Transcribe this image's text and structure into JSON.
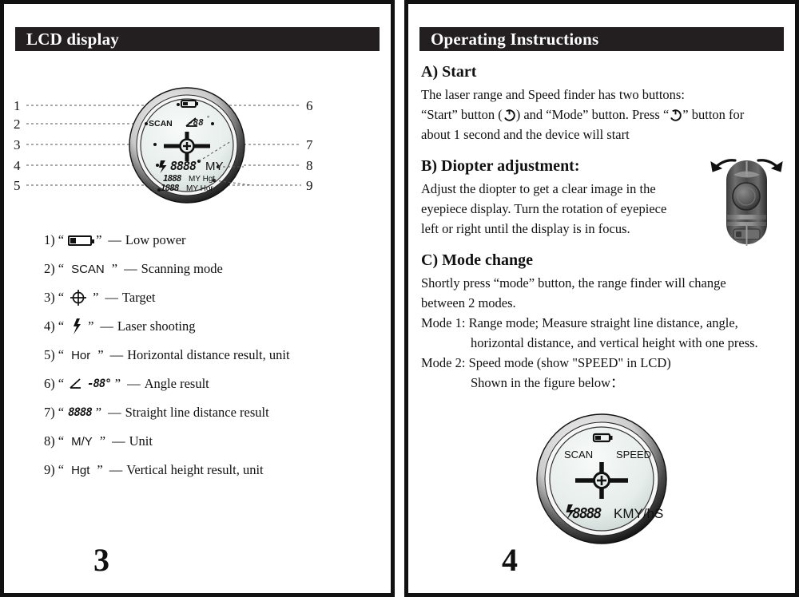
{
  "left_page": {
    "header_title": "LCD display",
    "page_number": "3",
    "figure": {
      "callouts_left": [
        "1",
        "2",
        "3",
        "4",
        "5"
      ],
      "callouts_right": [
        "6",
        "7",
        "8",
        "9"
      ],
      "lcd_labels": {
        "scan": "SCAN",
        "angle": "-88",
        "angle_degree": "°",
        "main_value": "8888",
        "main_unit": "MY",
        "hgt_value": "1888",
        "hgt_unit": "MY Hgt",
        "hor_value": "1888",
        "hor_unit": "MY Hor"
      }
    },
    "legend": [
      {
        "num": "1)",
        "symbol": "battery-icon",
        "symbol_kind": "battery",
        "symbol_text": "",
        "desc": "Low power"
      },
      {
        "num": "2)",
        "symbol": "scan-text",
        "symbol_kind": "text",
        "symbol_text": "SCAN",
        "desc": "Scanning mode"
      },
      {
        "num": "3)",
        "symbol": "target-icon",
        "symbol_kind": "target",
        "symbol_text": "",
        "desc": "Target"
      },
      {
        "num": "4)",
        "symbol": "laser-icon",
        "symbol_kind": "bolt",
        "symbol_text": "",
        "desc": "Laser shooting"
      },
      {
        "num": "5)",
        "symbol": "hor-text",
        "symbol_kind": "text",
        "symbol_text": "Hor",
        "desc": "Horizontal distance result, unit"
      },
      {
        "num": "6)",
        "symbol": "angle-seg",
        "symbol_kind": "angle",
        "symbol_text": "-88°",
        "desc": "Angle result"
      },
      {
        "num": "7)",
        "symbol": "digits-seg",
        "symbol_kind": "seg",
        "symbol_text": "8888",
        "desc": "Straight line distance result"
      },
      {
        "num": "8)",
        "symbol": "unit-text",
        "symbol_kind": "text",
        "symbol_text": "M/Y",
        "desc": "Unit"
      },
      {
        "num": "9)",
        "symbol": "hgt-text",
        "symbol_kind": "text",
        "symbol_text": "Hgt",
        "desc": "Vertical height result, unit"
      }
    ],
    "quote_open": "“",
    "quote_close": "”",
    "dash": "—"
  },
  "right_page": {
    "header_title": "Operating Instructions",
    "page_number": "4",
    "sections": {
      "a": {
        "heading": "A) Start",
        "line1": "The laser range and Speed finder has two buttons:",
        "line2_a": "“Start” button (",
        "line2_b": ") and “Mode” button. Press “",
        "line2_c": "” button for",
        "line3": "about 1 second and the device will start"
      },
      "b": {
        "heading": "B) Diopter adjustment:",
        "line1": "Adjust the diopter to get a clear image in the",
        "line2": "eyepiece display. Turn the rotation of eyepiece",
        "line3": "left or right until the display is in focus."
      },
      "c": {
        "heading": "C) Mode change",
        "line1": "Shortly press “mode” button, the range finder will change",
        "line2": "between 2 modes.",
        "line3": "Mode 1: Range mode; Measure straight line distance, angle,",
        "line4": "horizontal distance, and vertical height with one press.",
        "line5": "Mode 2: Speed mode (show \"SPEED\" in LCD)",
        "line6": "Shown in the figure below："
      }
    },
    "speed_figure": {
      "scan": "SCAN",
      "speed": "SPEED",
      "value": "8888",
      "unit": "KMY/hS"
    }
  },
  "colors": {
    "frame": "#111111",
    "header_bar": "#231f20",
    "header_text": "#ffffff",
    "body_text": "#111111",
    "lcd_face": "#e8eeec",
    "leader_line": "#555555"
  }
}
